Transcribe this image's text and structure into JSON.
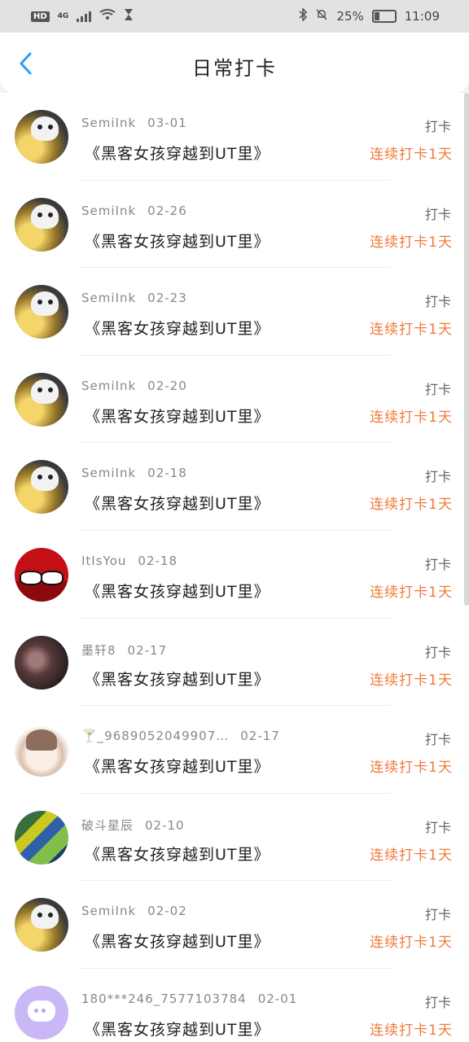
{
  "status_bar": {
    "hd": "HD",
    "network": "4G",
    "battery_text": "25%",
    "time": "11:09"
  },
  "header": {
    "title": "日常打卡"
  },
  "entries": [
    {
      "username": "SemiInk",
      "date": "03-01",
      "title": "《黑客女孩穿越到UT里》",
      "action": "打卡",
      "streak": "连续打卡1天",
      "avatar": "skull"
    },
    {
      "username": "SemiInk",
      "date": "02-26",
      "title": "《黑客女孩穿越到UT里》",
      "action": "打卡",
      "streak": "连续打卡1天",
      "avatar": "skull"
    },
    {
      "username": "SemiInk",
      "date": "02-23",
      "title": "《黑客女孩穿越到UT里》",
      "action": "打卡",
      "streak": "连续打卡1天",
      "avatar": "skull"
    },
    {
      "username": "SemiInk",
      "date": "02-20",
      "title": "《黑客女孩穿越到UT里》",
      "action": "打卡",
      "streak": "连续打卡1天",
      "avatar": "skull"
    },
    {
      "username": "SemiInk",
      "date": "02-18",
      "title": "《黑客女孩穿越到UT里》",
      "action": "打卡",
      "streak": "连续打卡1天",
      "avatar": "skull"
    },
    {
      "username": "ItIsYou",
      "date": "02-18",
      "title": "《黑客女孩穿越到UT里》",
      "action": "打卡",
      "streak": "连续打卡1天",
      "avatar": "ball"
    },
    {
      "username": "墨轩8",
      "date": "02-17",
      "title": "《黑客女孩穿越到UT里》",
      "action": "打卡",
      "streak": "连续打卡1天",
      "avatar": "dark"
    },
    {
      "username": "🍸_9689052049907…",
      "date": "02-17",
      "title": "《黑客女孩穿越到UT里》",
      "action": "打卡",
      "streak": "连续打卡1天",
      "avatar": "anime"
    },
    {
      "username": "破斗星辰",
      "date": "02-10",
      "title": "《黑客女孩穿越到UT里》",
      "action": "打卡",
      "streak": "连续打卡1天",
      "avatar": "crowd"
    },
    {
      "username": "SemiInk",
      "date": "02-02",
      "title": "《黑客女孩穿越到UT里》",
      "action": "打卡",
      "streak": "连续打卡1天",
      "avatar": "skull"
    },
    {
      "username": "180***246_7577103784",
      "date": "02-01",
      "title": "《黑客女孩穿越到UT里》",
      "action": "打卡",
      "streak": "连续打卡1天",
      "avatar": "chat"
    }
  ],
  "colors": {
    "accent_blue": "#2b9df5",
    "streak_orange": "#f07a3a"
  }
}
